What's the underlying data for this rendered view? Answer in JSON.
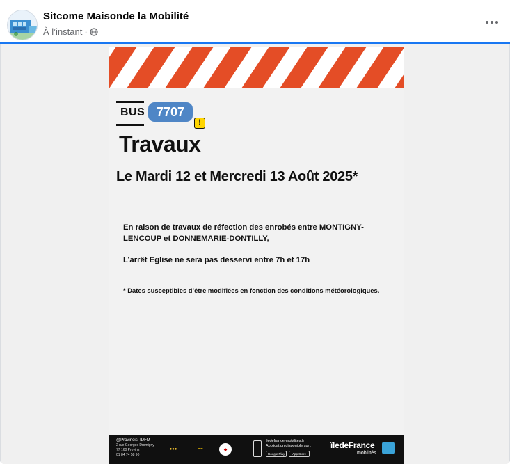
{
  "post": {
    "page_name": "Sitcome Maisonde la Mobilité",
    "timestamp": "À l’instant",
    "separator": "·",
    "privacy_icon": "globe-icon",
    "more_icon": "more-horizontal-icon"
  },
  "poster": {
    "bus_label": "BUS",
    "line_number": "7707",
    "warning_symbol": "!",
    "title": "Travaux",
    "date_line": "Le Mardi 12 et Mercredi 13 Août 2025*",
    "paragraph1": "En raison de travaux de réfection des enrobés entre MONTIGNY-LENCOUP et DONNEMARIE-DONTILLY,",
    "paragraph2": "L’arrêt Eglise ne sera pas desservi entre 7h et 17h",
    "footnote": "* Dates susceptibles d’être modifiées en fonction des conditions météorologiques.",
    "colors": {
      "stripe_orange": "#e44d26",
      "badge_blue": "#4f86c6",
      "warning_yellow": "#ffd500",
      "footer_black": "#101010"
    },
    "footer": {
      "social_handle": "@Provinois_IDFM",
      "address_line1": "2 rue Georges Dromigny",
      "address_line2": "77 160 Provins",
      "phone": "01 84 74 58 90",
      "website": "iledefrance-mobilites.fr",
      "app_text": "Application disponible sur :",
      "store1": "Google Play",
      "store2": "App Store",
      "brand": "îledeFrance",
      "brand_sub": "mobilités"
    }
  }
}
